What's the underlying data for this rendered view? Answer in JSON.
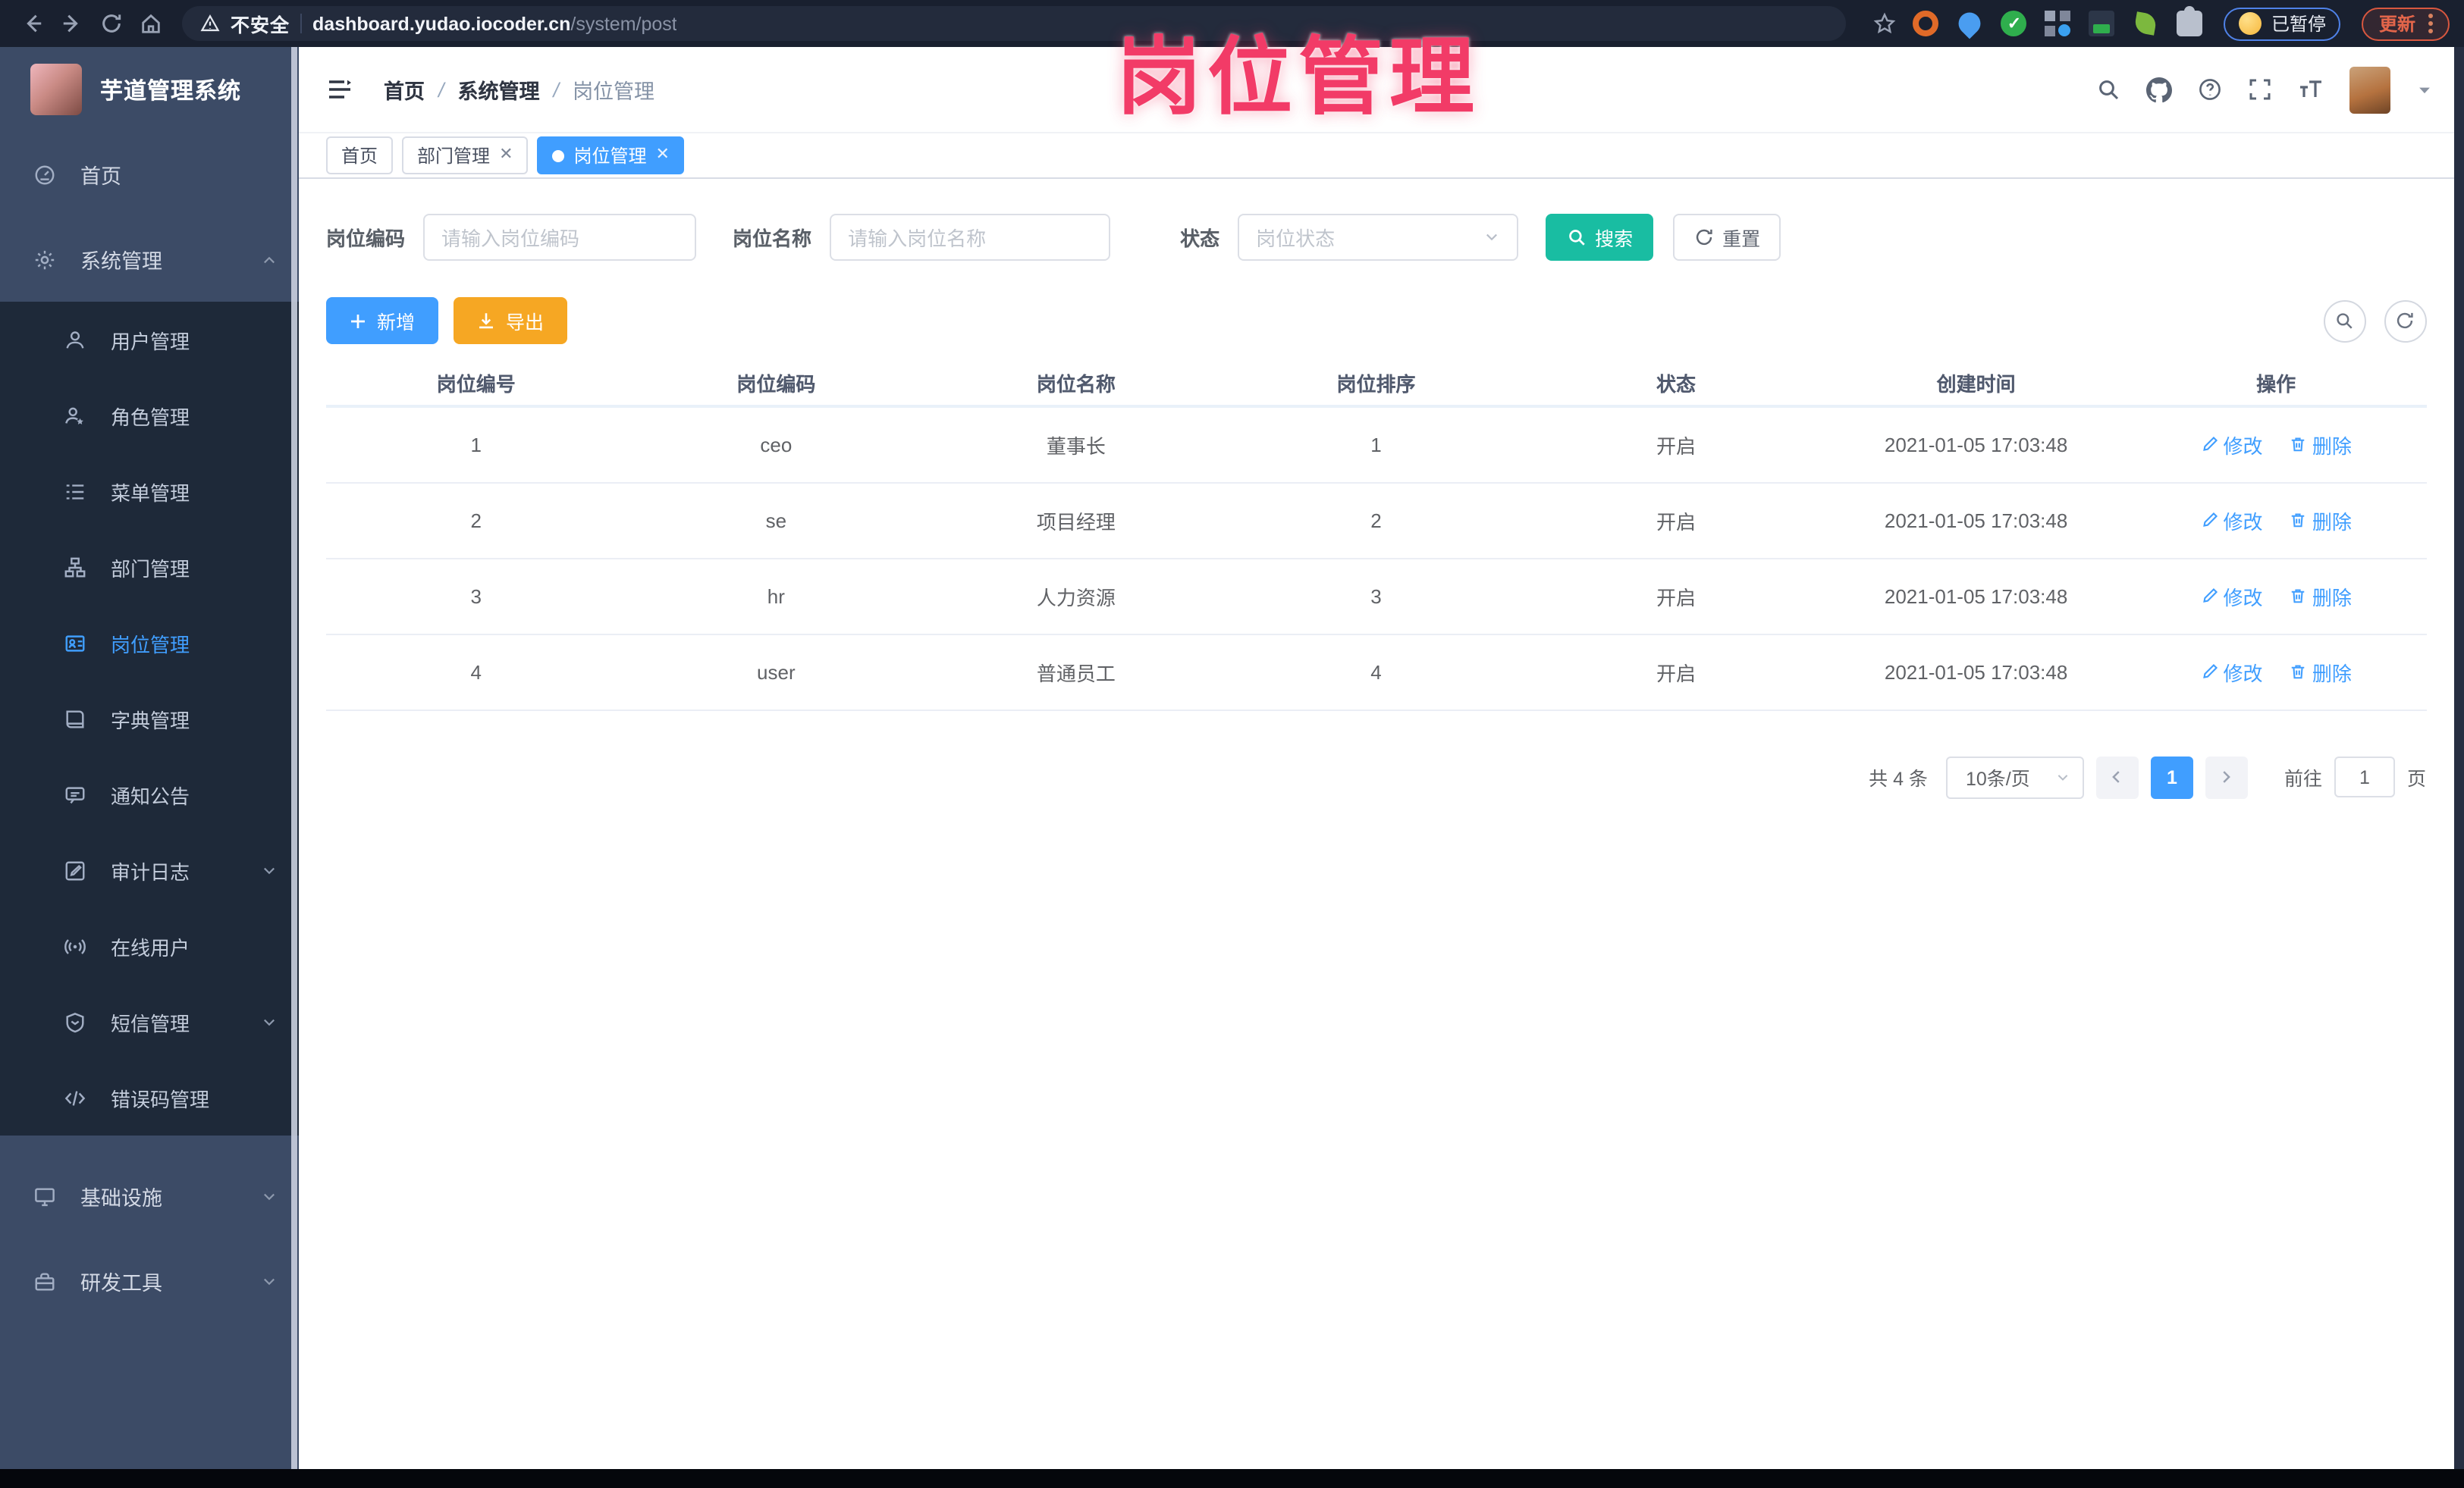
{
  "accent_colors": {
    "primary": "#409eff",
    "search_teal": "#19bda2",
    "export_orange": "#f6a723",
    "annotation_pink": "#f23b67"
  },
  "browser": {
    "security_label": "不安全",
    "url_host": "dashboard.yudao.iocoder.cn",
    "url_path": "/system/post",
    "paused_badge": "已暂停",
    "update_button": "更新"
  },
  "sidebar": {
    "app_title": "芋道管理系统",
    "items": [
      {
        "label": "首页"
      },
      {
        "label": "系统管理"
      },
      {
        "label": "用户管理"
      },
      {
        "label": "角色管理"
      },
      {
        "label": "菜单管理"
      },
      {
        "label": "部门管理"
      },
      {
        "label": "岗位管理"
      },
      {
        "label": "字典管理"
      },
      {
        "label": "通知公告"
      },
      {
        "label": "审计日志"
      },
      {
        "label": "在线用户"
      },
      {
        "label": "短信管理"
      },
      {
        "label": "错误码管理"
      },
      {
        "label": "基础设施"
      },
      {
        "label": "研发工具"
      }
    ]
  },
  "header": {
    "breadcrumb": [
      "首页",
      "系统管理",
      "岗位管理"
    ]
  },
  "tabs": [
    {
      "label": "首页"
    },
    {
      "label": "部门管理"
    },
    {
      "label": "岗位管理"
    }
  ],
  "watermark": "岗位管理",
  "filters": {
    "post_code_label": "岗位编码",
    "post_code_placeholder": "请输入岗位编码",
    "post_name_label": "岗位名称",
    "post_name_placeholder": "请输入岗位名称",
    "status_label": "状态",
    "status_placeholder": "岗位状态",
    "search_label": "搜索",
    "reset_label": "重置"
  },
  "toolbar": {
    "add_label": "新增",
    "export_label": "导出"
  },
  "table": {
    "columns": [
      "岗位编号",
      "岗位编码",
      "岗位名称",
      "岗位排序",
      "状态",
      "创建时间",
      "操作"
    ],
    "edit_label": "修改",
    "delete_label": "删除",
    "rows": [
      {
        "id": "1",
        "code": "ceo",
        "name": "董事长",
        "sort": "1",
        "status": "开启",
        "created": "2021-01-05 17:03:48"
      },
      {
        "id": "2",
        "code": "se",
        "name": "项目经理",
        "sort": "2",
        "status": "开启",
        "created": "2021-01-05 17:03:48"
      },
      {
        "id": "3",
        "code": "hr",
        "name": "人力资源",
        "sort": "3",
        "status": "开启",
        "created": "2021-01-05 17:03:48"
      },
      {
        "id": "4",
        "code": "user",
        "name": "普通员工",
        "sort": "4",
        "status": "开启",
        "created": "2021-01-05 17:03:48"
      }
    ]
  },
  "pagination": {
    "total_text": "共 4 条",
    "page_size": "10条/页",
    "current_page": "1",
    "goto_label": "前往",
    "goto_value": "1",
    "page_suffix": "页"
  }
}
